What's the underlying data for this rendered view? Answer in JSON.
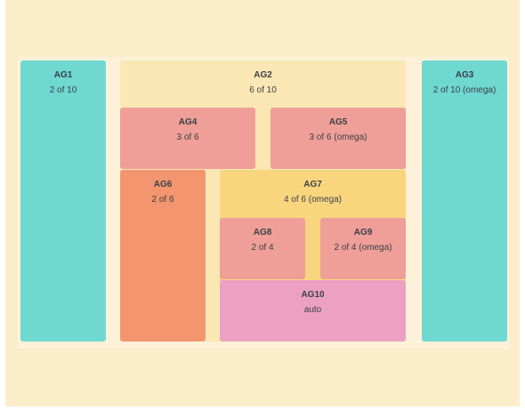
{
  "colors": {
    "background": "#fcedca",
    "teal": "#6fd9d1",
    "pale_yellow": "#fbe7b3",
    "salmon": "#ef9f98",
    "orange": "#f3966f",
    "yellow": "#f9d67e",
    "pink": "#eca1c3"
  },
  "areas": [
    {
      "name": "AG1",
      "span": "2 of 10"
    },
    {
      "name": "AG2",
      "span": "6 of 10"
    },
    {
      "name": "AG3",
      "span": "2 of 10 (omega)"
    },
    {
      "name": "AG4",
      "span": "3 of 6"
    },
    {
      "name": "AG5",
      "span": "3 of 6 (omega)"
    },
    {
      "name": "AG6",
      "span": "2 of 6"
    },
    {
      "name": "AG7",
      "span": "4 of 6 (omega)"
    },
    {
      "name": "AG8",
      "span": "2 of 4"
    },
    {
      "name": "AG9",
      "span": "2 of 4 (omega)"
    },
    {
      "name": "AG10",
      "span": "auto"
    }
  ]
}
